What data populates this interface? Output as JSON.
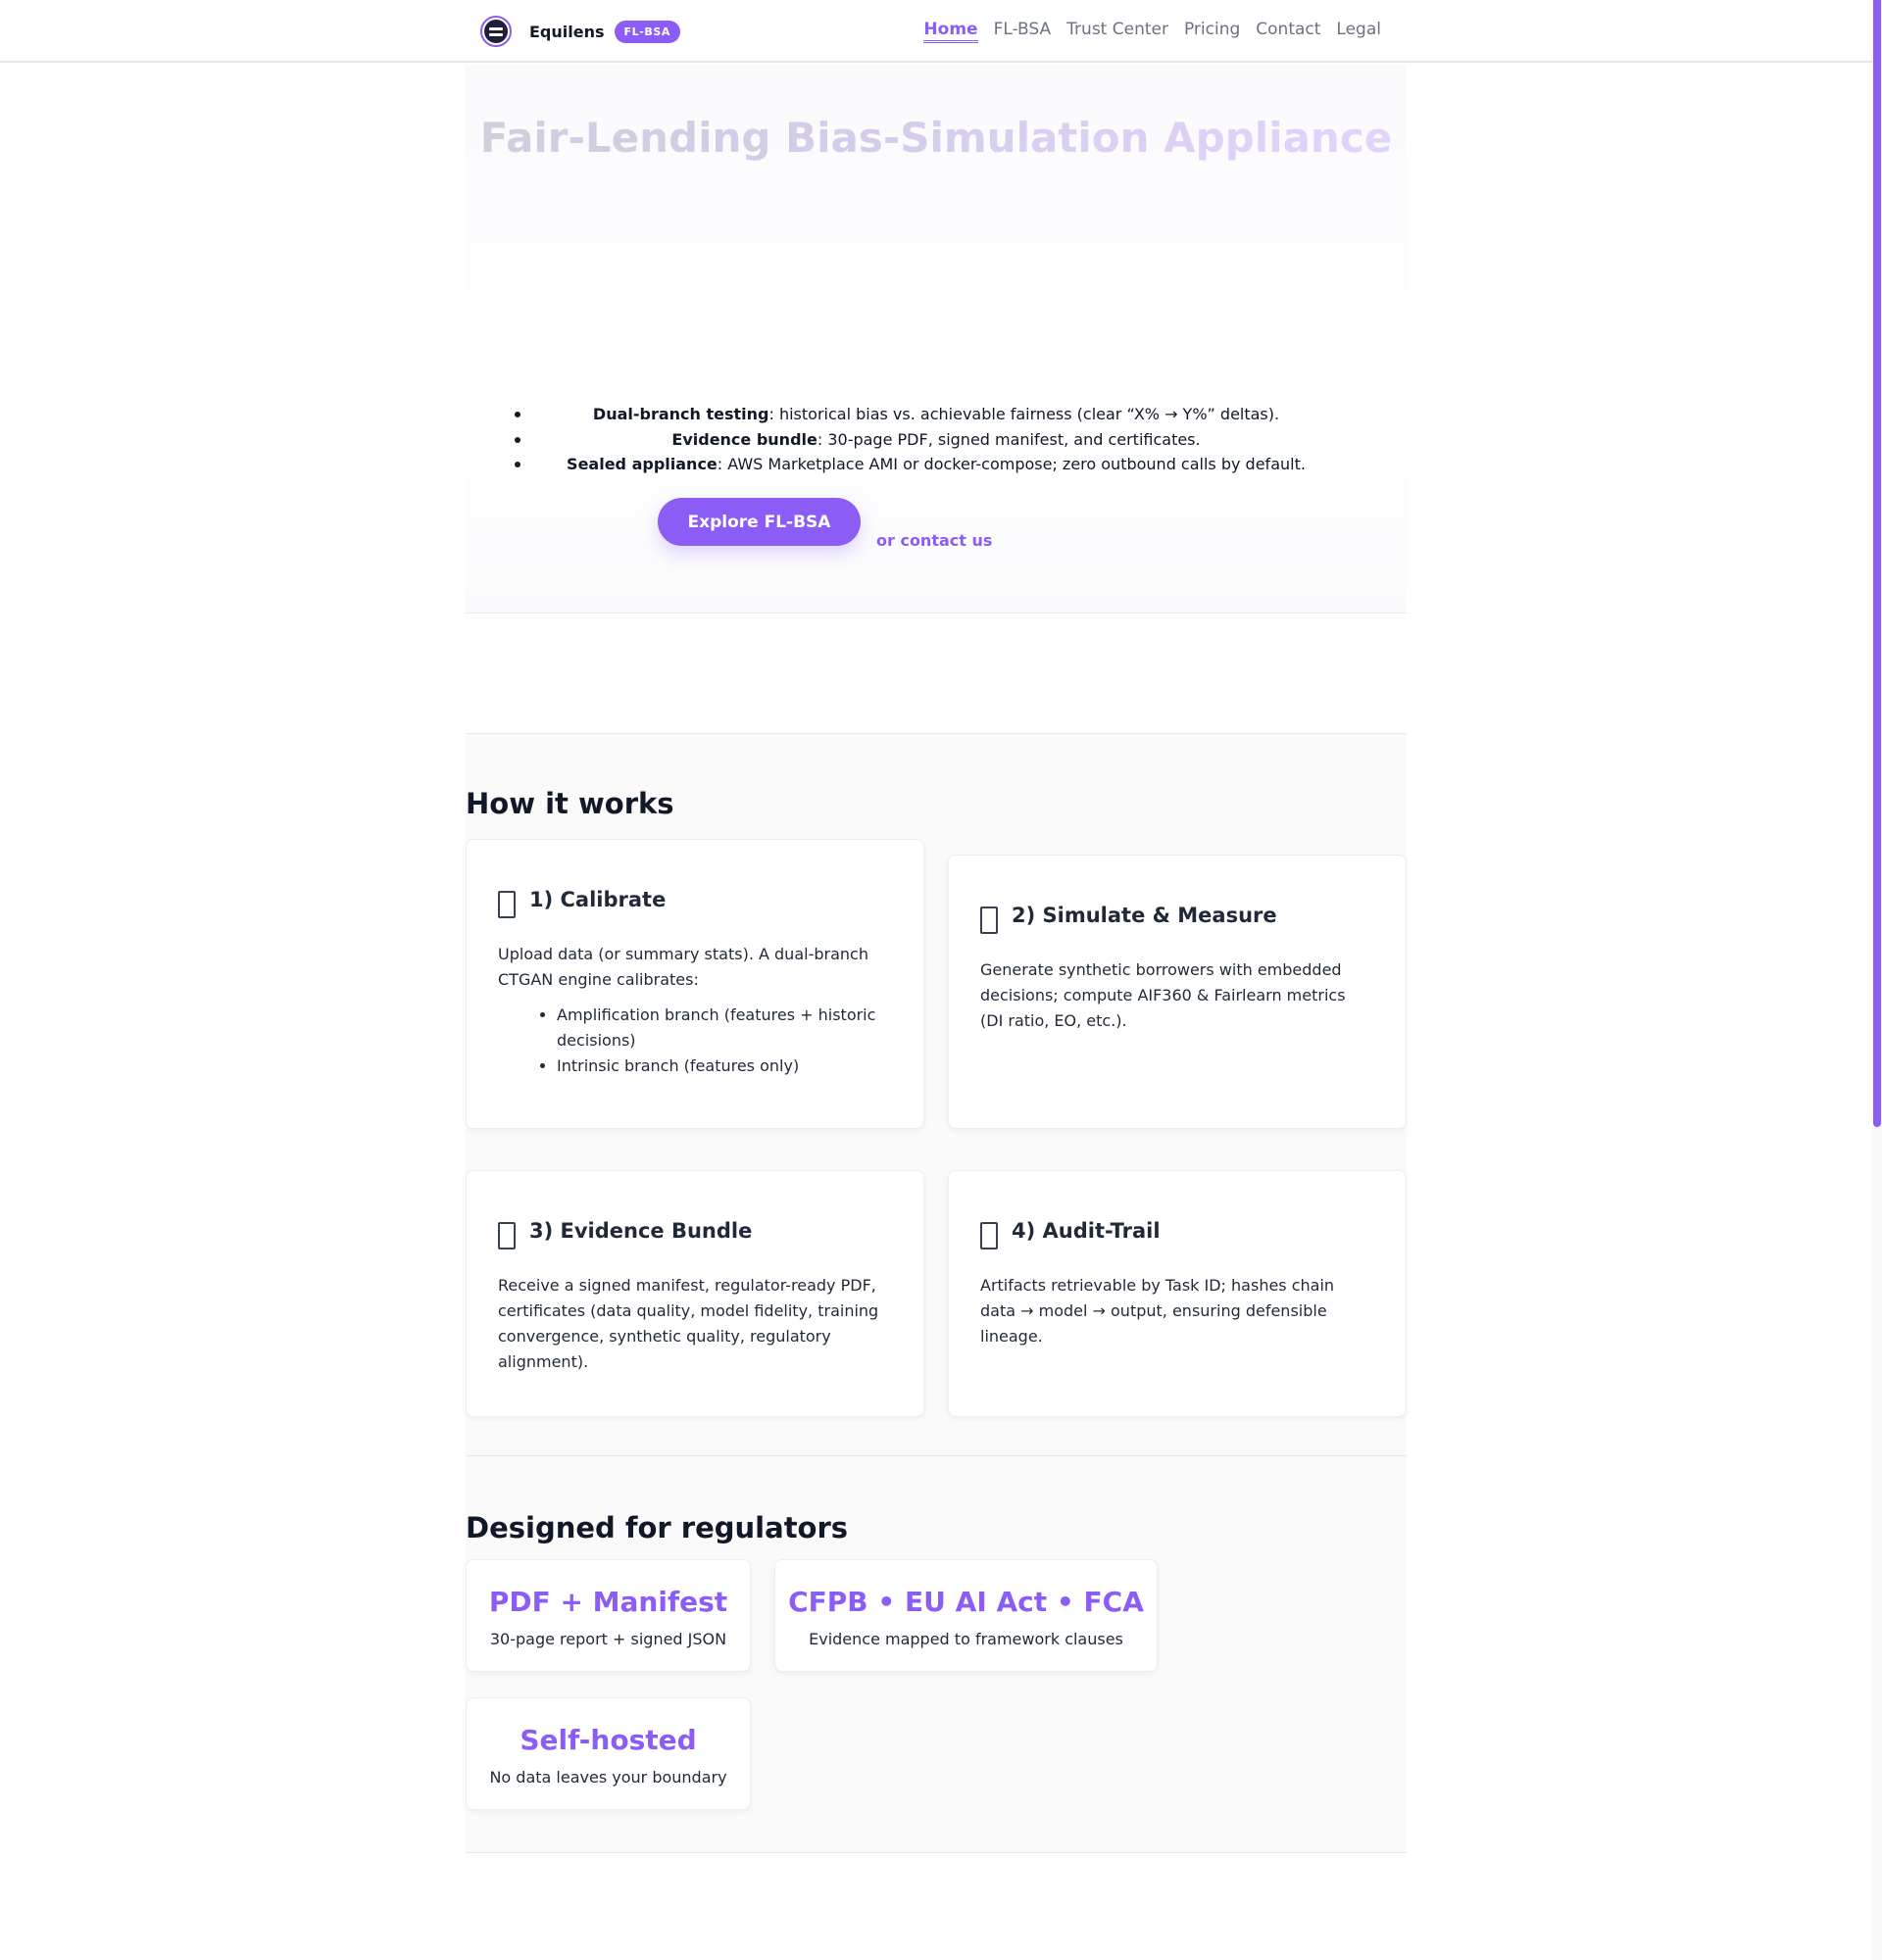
{
  "header": {
    "brand": "Equilens",
    "badge": "FL-BSA",
    "nav": [
      "Home",
      "FL-BSA",
      "Trust Center",
      "Pricing",
      "Contact",
      "Legal"
    ],
    "active_nav": "Home"
  },
  "hero": {
    "title": "Fair-Lending Bias-Simulation Appliance",
    "bullets": [
      {
        "bold": "Dual-branch testing",
        "text": ": historical bias vs. achievable fairness (clear “X% → Y%” deltas)."
      },
      {
        "bold": "Evidence bundle",
        "text": ": 30-page PDF, signed manifest, and certificates."
      },
      {
        "bold": "Sealed appliance",
        "text": ": AWS Marketplace AMI or docker-compose; zero outbound calls by default."
      }
    ],
    "cta_label": "Explore FL-BSA",
    "contact_label": "or contact us"
  },
  "how": {
    "heading": "How it works",
    "steps": [
      {
        "title": "1) Calibrate",
        "body": "Upload data (or summary stats). A dual-branch CTGAN engine calibrates:",
        "bullets": [
          "Amplification branch (features + historic decisions)",
          "Intrinsic branch (features only)"
        ]
      },
      {
        "title": "2) Simulate & Measure",
        "body": "Generate synthetic borrowers with embedded decisions; compute AIF360 & Fairlearn metrics (DI ratio, EO, etc.)."
      },
      {
        "title": "3) Evidence Bundle",
        "body": "Receive a signed manifest, regulator-ready PDF, certificates (data quality, model fidelity, training convergence, synthetic quality, regulatory alignment)."
      },
      {
        "title": "4) Audit-Trail",
        "body": "Artifacts retrievable by Task ID; hashes chain data → model → output, ensuring defensible lineage."
      }
    ]
  },
  "regulators": {
    "heading": "Designed for regulators",
    "stats": [
      {
        "title": "PDF + Manifest",
        "subtitle": "30-page report + signed JSON"
      },
      {
        "title": "CFPB • EU AI Act • FCA",
        "subtitle": "Evidence mapped to framework clauses"
      },
      {
        "title": "Self-hosted",
        "subtitle": "No data leaves your boundary"
      }
    ]
  },
  "colors": {
    "accent": "#8b5cf6",
    "text": "#111827",
    "muted": "#6b7280"
  }
}
